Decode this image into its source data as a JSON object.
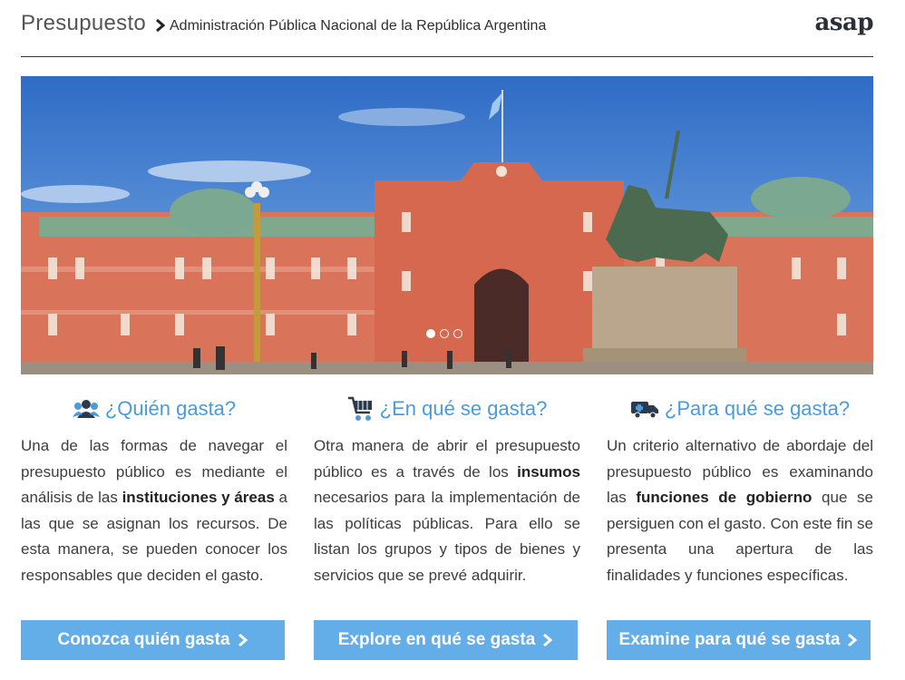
{
  "header": {
    "title": "Presupuesto",
    "breadcrumb": "Administración Pública Nacional de la República Argentina",
    "logo_text": "asap"
  },
  "carousel": {
    "slides": 3,
    "active_index": 0,
    "image_description_icon": "casa-rosada-photo"
  },
  "sections": [
    {
      "icon": "users-icon",
      "title": "¿Quién gasta?",
      "text_parts": [
        {
          "t": "Una de las formas de navegar el presupuesto público es mediante el análisis de las ",
          "b": false
        },
        {
          "t": "instituciones y áreas",
          "b": true
        },
        {
          "t": " a las que se asignan los recursos. De esta manera, se pueden conocer los responsables que deciden el gasto.",
          "b": false
        }
      ],
      "button": "Conozca quién gasta"
    },
    {
      "icon": "cart-icon",
      "title": "¿En qué se gasta?",
      "text_parts": [
        {
          "t": "Otra manera de abrir el presupuesto público es a través de los ",
          "b": false
        },
        {
          "t": "insumos",
          "b": true
        },
        {
          "t": " necesarios para la implementación de las políticas públicas. Para ello se listan los grupos y tipos de bienes y servicios que se prevé adquirir.",
          "b": false
        }
      ],
      "button": "Explore en qué se gasta"
    },
    {
      "icon": "ambulance-icon",
      "title": "¿Para qué se gasta?",
      "text_parts": [
        {
          "t": "Un criterio alternativo de abordaje del presupuesto público es examinando las ",
          "b": false
        },
        {
          "t": "funciones de gobierno",
          "b": true
        },
        {
          "t": " que se persiguen con el gasto. Con este fin se presenta una apertura de las finalidades y funciones específicas.",
          "b": false
        }
      ],
      "button": "Examine para qué se gasta"
    }
  ],
  "colors": {
    "accent": "#4a9bd8",
    "button": "#63aee8",
    "facade": "#d9735a"
  }
}
